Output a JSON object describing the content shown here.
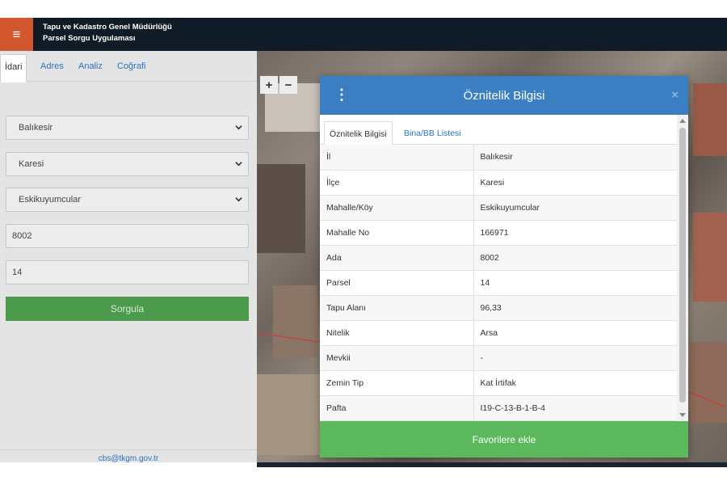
{
  "header": {
    "org_title": "Tapu ve Kadastro Genel Müdürlüğü",
    "app_title": "Parsel Sorgu Uygulaması",
    "menu_icon": "hamburger-menu-icon",
    "accent_color": "#d2572e"
  },
  "left_panel": {
    "tabs": [
      {
        "label": "İdari",
        "active": true
      },
      {
        "label": "Adres"
      },
      {
        "label": "Analiz"
      },
      {
        "label": "Coğrafi"
      }
    ],
    "province_select": "Balıkesir",
    "district_select": "Karesi",
    "neighborhood_select": "Eskikuyumcular",
    "block_input": "8002",
    "parcel_input": "14",
    "submit_label": "Sorgula",
    "footer_email": "cbs@tkgm.gov.tr"
  },
  "map": {
    "zoom_in": "+",
    "zoom_out": "−"
  },
  "modal": {
    "title": "Öznitelik Bilgisi",
    "close": "×",
    "menu_icon": "vertical-dots-icon",
    "tabs": [
      {
        "label": "Öznitelik Bilgisi",
        "active": true
      },
      {
        "label": "Bina/BB Listesi"
      }
    ],
    "rows": [
      {
        "key": "İl",
        "value": "Balıkesir"
      },
      {
        "key": "İlçe",
        "value": "Karesi"
      },
      {
        "key": "Mahalle/Köy",
        "value": "Eskikuyumcular"
      },
      {
        "key": "Mahalle No",
        "value": "166971"
      },
      {
        "key": "Ada",
        "value": "8002"
      },
      {
        "key": "Parsel",
        "value": "14"
      },
      {
        "key": "Tapu Alanı",
        "value": "96,33"
      },
      {
        "key": "Nitelik",
        "value": "Arsa"
      },
      {
        "key": "Mevkii",
        "value": "-"
      },
      {
        "key": "Zemin Tip",
        "value": "Kat İrtifak"
      },
      {
        "key": "Pafta",
        "value": "I19-C-13-B-1-B-4"
      }
    ],
    "favorite_label": "Favorilere ekle",
    "header_color": "#3b7fc2",
    "favorite_color": "#5cb85c"
  }
}
